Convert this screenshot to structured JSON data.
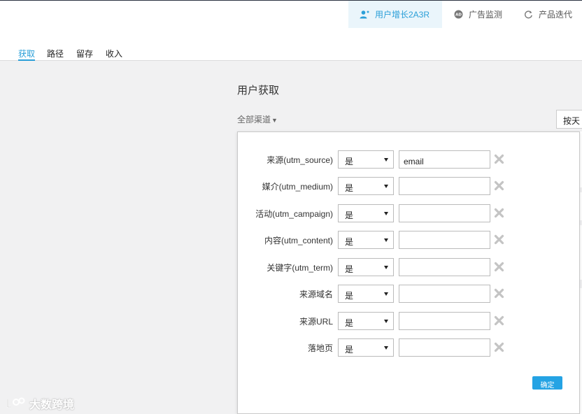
{
  "header": {
    "tabs": [
      {
        "label": "用户增长2A3R",
        "icon": "user-growth-icon",
        "active": true
      },
      {
        "label": "广告监测",
        "icon": "ad-icon",
        "active": false
      },
      {
        "label": "产品迭代",
        "icon": "refresh-icon",
        "active": false
      }
    ]
  },
  "subnav": {
    "tabs": [
      {
        "label": "获取",
        "active": true
      },
      {
        "label": "路径",
        "active": false
      },
      {
        "label": "留存",
        "active": false
      },
      {
        "label": "收入",
        "active": false
      }
    ]
  },
  "main": {
    "title": "用户获取",
    "channel_dropdown": "全部渠道",
    "right_button": "按天"
  },
  "filter_panel": {
    "rows": [
      {
        "label": "来源(utm_source)",
        "operator": "是",
        "value": "email"
      },
      {
        "label": "媒介(utm_medium)",
        "operator": "是",
        "value": ""
      },
      {
        "label": "活动(utm_campaign)",
        "operator": "是",
        "value": ""
      },
      {
        "label": "内容(utm_content)",
        "operator": "是",
        "value": ""
      },
      {
        "label": "关键字(utm_term)",
        "operator": "是",
        "value": ""
      },
      {
        "label": "来源域名",
        "operator": "是",
        "value": ""
      },
      {
        "label": "来源URL",
        "operator": "是",
        "value": ""
      },
      {
        "label": "落地页",
        "operator": "是",
        "value": ""
      }
    ],
    "confirm_label": "确定"
  },
  "watermark": {
    "text": "大数跨境"
  },
  "colors": {
    "accent": "#2a9fd8",
    "confirm_button": "#24a3e4",
    "background": "#f1f1f2"
  }
}
